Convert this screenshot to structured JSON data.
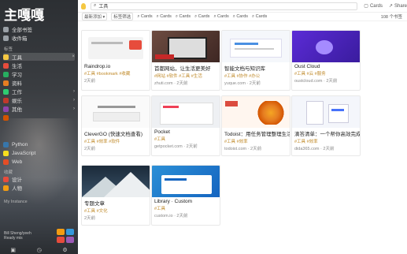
{
  "sidebar": {
    "logo": "主嘎嘎",
    "top_items": [
      {
        "label": "全部书签",
        "icon_color": "#9aa0a6",
        "icon": "bookmarks-icon"
      },
      {
        "label": "收件箱",
        "icon_color": "#9aa0a6",
        "icon": "inbox-icon"
      }
    ],
    "section1": "标签",
    "tag_items": [
      {
        "label": "工具",
        "icon_color": "#f5c842",
        "active": true,
        "chev": "×"
      },
      {
        "label": "生活",
        "icon_color": "#e74c3c",
        "chev": ""
      },
      {
        "label": "学习",
        "icon_color": "#27ae60",
        "chev": ""
      },
      {
        "label": "资料",
        "icon_color": "#e67e22",
        "chev": ""
      },
      {
        "label": "工作",
        "icon_color": "#2ecc71",
        "chev": "›"
      },
      {
        "label": "娱乐",
        "icon_color": "#c0392b",
        "chev": "›"
      },
      {
        "label": "其他",
        "icon_color": "#8e44ad",
        "chev": "›"
      },
      {
        "label": "",
        "icon_color": "#d35400",
        "chev": ""
      }
    ],
    "lang_items": [
      {
        "label": "Python",
        "icon_color": "#3776ab"
      },
      {
        "label": "JavaScript",
        "icon_color": "#f7df1e"
      },
      {
        "label": "Web",
        "icon_color": "#e44d26"
      }
    ],
    "section2": "收藏",
    "fav_items": [
      {
        "label": "设计",
        "icon_color": "#e74c3c"
      },
      {
        "label": "人物",
        "icon_color": "#f39c12"
      }
    ],
    "section3": "My Instance",
    "user_line1": "Bill Sheng/yeeh",
    "user_line2": "Ready mis",
    "tiles": [
      "#f39c12",
      "#3498db",
      "#e74c3c",
      "#9b59b6"
    ],
    "bottom_icons": [
      "▣",
      "◷",
      "⚙"
    ]
  },
  "topbar": {
    "search_value": "工具",
    "action1": "Cards",
    "action2": "Share"
  },
  "filterbar": {
    "items": [
      "最新添加 ▾",
      "标签筛选",
      "⌕ Cards",
      "⌕ Cards",
      "⌕ Cards",
      "⌕ Cards",
      "⌕ Cards",
      "⌕ Cards",
      "⌕ Cards"
    ],
    "right": "108 个书签"
  },
  "cards": [
    {
      "title": "Raindrop.io",
      "tags": "#工具 #bookmark #收藏",
      "meta": "2天前",
      "thumb": "raindrop"
    },
    {
      "title": "首都网站，让生活更美好",
      "tags": "#网站 #软件 #工具 #生活",
      "meta": "zhuti.com · 2天前",
      "thumb": "laptop"
    },
    {
      "title": "智能文档与知识库",
      "tags": "#工具 #协作 #办公",
      "meta": "yuque.com · 2天前",
      "thumb": "doc"
    },
    {
      "title": "Oust Cloud",
      "tags": "#工具 #云 #服务",
      "meta": "oustcloud.com · 2天前",
      "thumb": "purple"
    },
    {
      "title": "CleverGO (快速文档查看)",
      "tags": "#工具 #效率 #软件",
      "meta": "2天前",
      "thumb": "white"
    },
    {
      "title": "Pocket",
      "tags": "#工具",
      "meta": "getpocket.com · 2天前",
      "thumb": "pocket"
    },
    {
      "title": "Todoist：用任务管理整理生活",
      "tags": "#工具 #效率",
      "meta": "todoist.com · 2天前",
      "thumb": "todoist"
    },
    {
      "title": "滴答清单：一个帮你高效完成任务的清单",
      "tags": "#工具 #效率",
      "meta": "dida365.com · 2天前",
      "thumb": "dida"
    },
    {
      "title": "专题文章",
      "tags": "#工具 #文化",
      "meta": "2天前",
      "thumb": "mountain"
    },
    {
      "title": "Library · Custom",
      "tags": "#工具",
      "meta": "custom.io · 2天前",
      "thumb": "library"
    }
  ]
}
